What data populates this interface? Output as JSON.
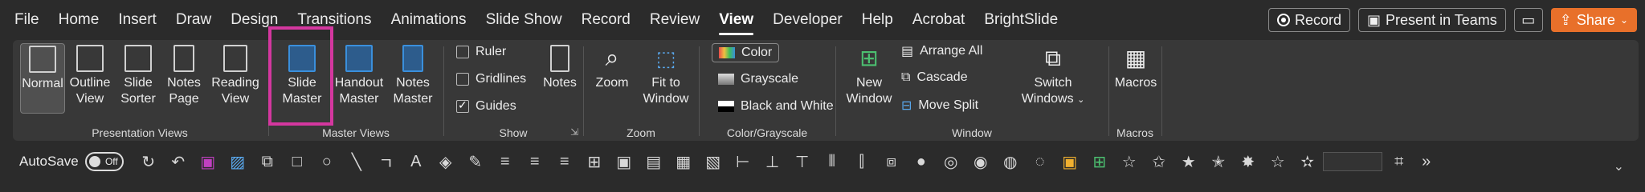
{
  "menu": {
    "tabs": [
      "File",
      "Home",
      "Insert",
      "Draw",
      "Design",
      "Transitions",
      "Animations",
      "Slide Show",
      "Record",
      "Review",
      "View",
      "Developer",
      "Help",
      "Acrobat",
      "BrightSlide"
    ],
    "active_tab": "View",
    "record_label": "Record",
    "present_label": "Present in Teams",
    "share_label": "Share"
  },
  "ribbon": {
    "presentation_views": {
      "label": "Presentation Views",
      "normal": "Normal",
      "outline_1": "Outline",
      "outline_2": "View",
      "sorter_1": "Slide",
      "sorter_2": "Sorter",
      "notes_1": "Notes",
      "notes_2": "Page",
      "reading_1": "Reading",
      "reading_2": "View"
    },
    "master_views": {
      "label": "Master Views",
      "slide_1": "Slide",
      "slide_2": "Master",
      "handout_1": "Handout",
      "handout_2": "Master",
      "notes_1": "Notes",
      "notes_2": "Master"
    },
    "show": {
      "label": "Show",
      "ruler": "Ruler",
      "gridlines": "Gridlines",
      "guides": "Guides",
      "notes": "Notes"
    },
    "zoom": {
      "label": "Zoom",
      "zoom": "Zoom",
      "fit_1": "Fit to",
      "fit_2": "Window"
    },
    "color": {
      "label": "Color/Grayscale",
      "color": "Color",
      "grayscale": "Grayscale",
      "bw": "Black and White"
    },
    "window": {
      "label": "Window",
      "new_1": "New",
      "new_2": "Window",
      "arrange": "Arrange All",
      "cascade": "Cascade",
      "move_split": "Move Split",
      "switch_1": "Switch",
      "switch_2": "Windows"
    },
    "macros": {
      "label": "Macros",
      "macros": "Macros"
    }
  },
  "qat": {
    "autosave": "AutoSave",
    "toggle": "Off"
  },
  "colors": {
    "accent_orange": "#e8702a",
    "highlight_box": "#d4379f",
    "save_icon": "#c040c0"
  }
}
